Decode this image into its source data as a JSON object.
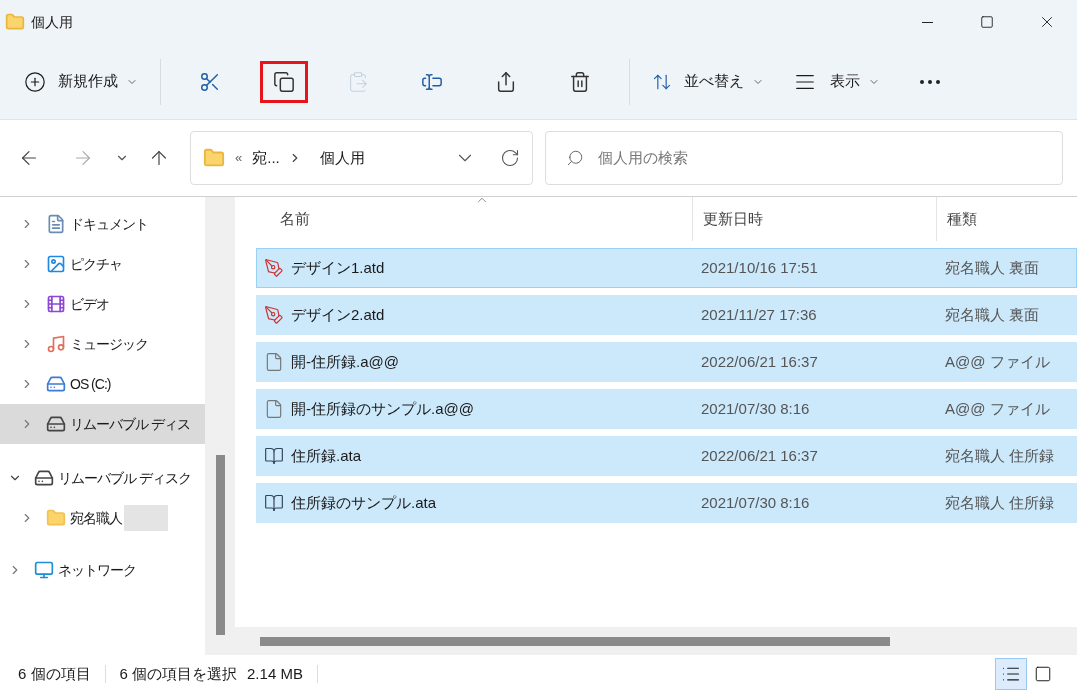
{
  "window": {
    "title": "個人用"
  },
  "toolbar": {
    "new_button": {
      "label": "新規作成"
    },
    "actions": [
      {
        "kind": "cut",
        "disabled": false,
        "highlighted": false
      },
      {
        "kind": "copy",
        "disabled": false,
        "highlighted": true
      },
      {
        "kind": "paste",
        "disabled": true,
        "highlighted": false
      },
      {
        "kind": "rename",
        "disabled": false,
        "highlighted": false
      },
      {
        "kind": "share",
        "disabled": false,
        "highlighted": false
      },
      {
        "kind": "delete",
        "disabled": false,
        "highlighted": false
      }
    ],
    "sort_button": {
      "label": "並べ替え"
    },
    "view_button": {
      "label": "表示"
    }
  },
  "navigation": {
    "back_disabled": false,
    "forward_disabled": true
  },
  "address_bar": {
    "overflow": "«",
    "crumbs": [
      "宛...",
      "個人用"
    ]
  },
  "search": {
    "placeholder": "個人用の検索"
  },
  "sidebar": {
    "pc_children": [
      {
        "kind": "documents",
        "label": "ドキュメント",
        "selected": false
      },
      {
        "kind": "pictures",
        "label": "ピクチャ",
        "selected": false
      },
      {
        "kind": "videos",
        "label": "ビデオ",
        "selected": false
      },
      {
        "kind": "music",
        "label": "ミュージック",
        "selected": false
      },
      {
        "kind": "os-drive",
        "label": "OS (C:)",
        "selected": false
      },
      {
        "kind": "drive",
        "label": "リムーバブル ディス",
        "selected": true
      }
    ],
    "items": [
      {
        "kind": "drive",
        "label": "リムーバブル ディスク",
        "selected": false,
        "expanded": true,
        "children": [
          {
            "kind": "folder",
            "label": "宛名職人",
            "selected": false,
            "redacted": true
          }
        ]
      },
      {
        "kind": "network",
        "label": "ネットワーク",
        "selected": false,
        "expanded": false
      }
    ]
  },
  "file_list": {
    "columns": [
      "名前",
      "更新日時",
      "種類"
    ],
    "rows": [
      {
        "kind": "design",
        "name": "デザイン1.atd",
        "modified": "2021/10/16 17:51",
        "type": "宛名職人 裏面",
        "selected": true,
        "focused": true
      },
      {
        "kind": "design",
        "name": "デザイン2.atd",
        "modified": "2021/11/27 17:36",
        "type": "宛名職人 裏面",
        "selected": true,
        "focused": false
      },
      {
        "kind": "blank",
        "name": "開-住所録.a@@",
        "modified": "2022/06/21 16:37",
        "type": "A@@ ファイル",
        "selected": true,
        "focused": false
      },
      {
        "kind": "blank",
        "name": "開-住所録のサンプル.a@@",
        "modified": "2021/07/30 8:16",
        "type": "A@@ ファイル",
        "selected": true,
        "focused": false
      },
      {
        "kind": "address",
        "name": "住所録.ata",
        "modified": "2022/06/21 16:37",
        "type": "宛名職人 住所録",
        "selected": true,
        "focused": false
      },
      {
        "kind": "address",
        "name": "住所録のサンプル.ata",
        "modified": "2021/07/30 8:16",
        "type": "宛名職人 住所録",
        "selected": true,
        "focused": false
      }
    ]
  },
  "status_bar": {
    "count": "6 個の項目",
    "selection": "6 個の項目を選択",
    "size": "2.14 MB",
    "views": [
      {
        "selected": true
      },
      {
        "selected": false
      }
    ]
  }
}
